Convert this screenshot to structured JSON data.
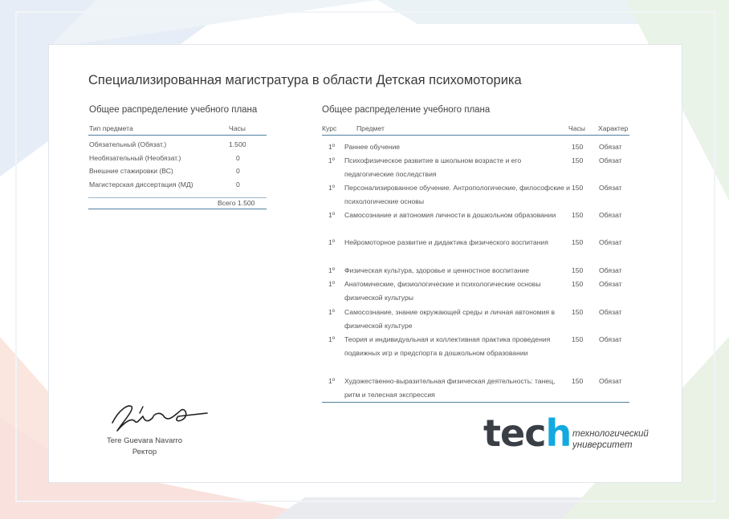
{
  "title": "Специализированная магистратура в области Детская психомоторика",
  "left_table": {
    "heading": "Общее распределение учебного плана",
    "col_type": "Тип предмета",
    "col_hours": "Часы",
    "rows": [
      {
        "type": "Обязательный (Обязат.)",
        "hours": "1.500"
      },
      {
        "type": "Необязательный (Необязат.)",
        "hours": "0"
      },
      {
        "type": "Внешние стажировки (ВС)",
        "hours": "0"
      },
      {
        "type": "Магистерская диссертация (МД)",
        "hours": "0"
      }
    ],
    "total": "Всего 1.500"
  },
  "right_table": {
    "heading": "Общее распределение учебного плана",
    "col_course": "Курс",
    "col_subject": "Предмет",
    "col_hours": "Часы",
    "col_type": "Характер",
    "rows": [
      {
        "course": "1º",
        "subject": "Раннее обучение",
        "hours": "150",
        "type": "Обязат"
      },
      {
        "course": "1º",
        "subject": "Психофизическое развитие в школьном возрасте и его педагогические последствия",
        "hours": "150",
        "type": "Обязат"
      },
      {
        "course": "1º",
        "subject": "Персонализированное обучение. Антропологические, философские и психологические основы",
        "hours": "150",
        "type": "Обязат"
      },
      {
        "course": "1º",
        "subject": "Самосознание и автономия личности в дошкольном образовании",
        "hours": "150",
        "type": "Обязат"
      },
      {
        "course": "1º",
        "subject": "Нейромоторное развитие и дидактика физического воспитания",
        "hours": "150",
        "type": "Обязат"
      },
      {
        "course": "1º",
        "subject": "Физическая культура, здоровье и ценностное воспитание",
        "hours": "150",
        "type": "Обязат"
      },
      {
        "course": "1º",
        "subject": "Анатомические, физиологические и психологические основы физической культуры",
        "hours": "150",
        "type": "Обязат"
      },
      {
        "course": "1º",
        "subject": "Самосознание, знание окружающей среды и личная автономия в физической культуре",
        "hours": "150",
        "type": "Обязат"
      },
      {
        "course": "1º",
        "subject": "Теория и индивидуальная и коллективная практика проведения подвижных игр и предспорта в дошкольном образовании",
        "hours": "150",
        "type": "Обязат"
      },
      {
        "course": "1º",
        "subject": "Художественно-выразительная физическая деятельность: танец, ритм и телесная экспрессия",
        "hours": "150",
        "type": "Обязат"
      }
    ]
  },
  "signature": {
    "name": "Tere Guevara Navarro",
    "role": "Ректор"
  },
  "logo": {
    "main_a": "tec",
    "main_b": "h",
    "sub_line1": "технологический",
    "sub_line2": "университет"
  },
  "colors": {
    "accent": "#11a9e0",
    "rule": "#4f7f9f",
    "logo_dark": "#3a3f46"
  }
}
